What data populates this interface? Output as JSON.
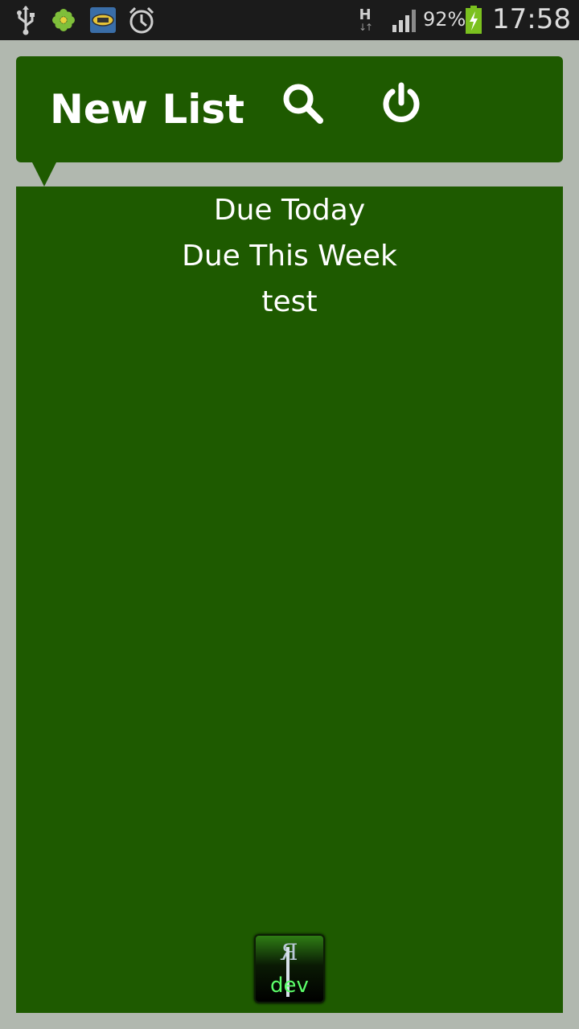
{
  "status_bar": {
    "network": "H",
    "battery_percent": "92%",
    "time": "17:58",
    "icons": [
      "usb-icon",
      "flower-icon",
      "app-notification-icon",
      "alarm-icon",
      "network-h-icon",
      "signal-icon",
      "battery-charging-icon"
    ]
  },
  "header": {
    "title": "New List",
    "search_icon": "search-icon",
    "power_icon": "power-icon",
    "color": "#1e5a00"
  },
  "lists": {
    "items": [
      {
        "label": "Due Today"
      },
      {
        "label": "Due This Week"
      },
      {
        "label": "test"
      }
    ]
  },
  "logo": {
    "icon": "dev-logo-icon",
    "text": "dev"
  },
  "colors": {
    "background": "#b1b8af",
    "panel": "#1e5a00",
    "status_bar": "#1b1b1b"
  }
}
